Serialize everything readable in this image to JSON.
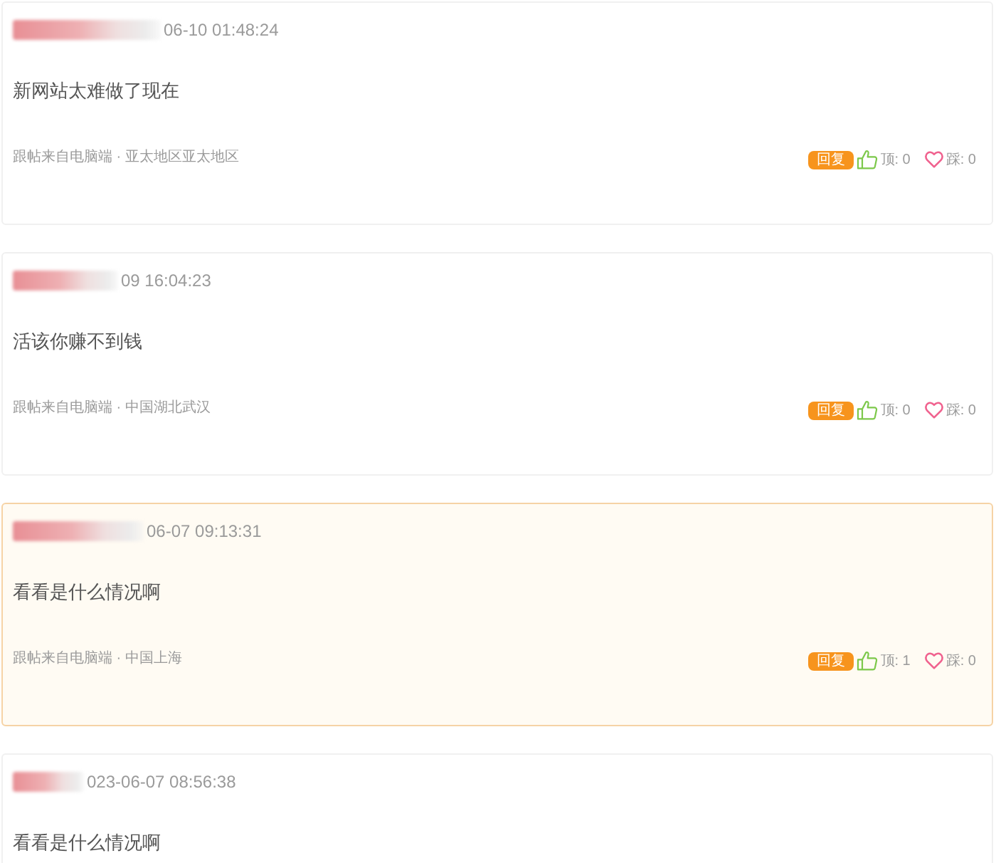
{
  "comments": [
    {
      "highlighted": false,
      "time": "06-10 01:48:24",
      "text": "新网站太难做了现在",
      "source": "跟帖来自电脑端 · 亚太地区亚太地区",
      "reply": "回复",
      "up": "顶: 0",
      "down": "踩: 0"
    },
    {
      "highlighted": false,
      "time": "09 16:04:23",
      "text": "活该你赚不到钱",
      "source": "跟帖来自电脑端 · 中国湖北武汉",
      "reply": "回复",
      "up": "顶: 0",
      "down": "踩: 0"
    },
    {
      "highlighted": true,
      "time": "06-07 09:13:31",
      "text": "看看是什么情况啊",
      "source": "跟帖来自电脑端 · 中国上海",
      "reply": "回复",
      "up": "顶: 1",
      "down": "踩: 0"
    },
    {
      "highlighted": false,
      "time": "023-06-07 08:56:38",
      "text": "看看是什么情况啊"
    }
  ]
}
